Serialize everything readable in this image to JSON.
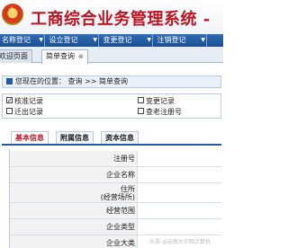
{
  "app": {
    "title": "工商综合业务管理系统 -"
  },
  "menu": [
    {
      "label": "名称登记"
    },
    {
      "label": "设立登记"
    },
    {
      "label": "变更登记"
    },
    {
      "label": "注销登记"
    }
  ],
  "tabs": [
    {
      "label": "欢迎页面"
    },
    {
      "label": "简单查询"
    }
  ],
  "location": {
    "text": "您现在的位置： 查询 >> 简单查询"
  },
  "checkboxes": [
    {
      "label": "核准记录",
      "checked": true
    },
    {
      "label": "变更记录",
      "checked": false
    },
    {
      "label": "迁出记录",
      "checked": false
    },
    {
      "label": "查老注册号",
      "checked": false
    }
  ],
  "subtabs": [
    {
      "label": "基本信息"
    },
    {
      "label": "附属信息"
    },
    {
      "label": "资本信息"
    }
  ],
  "form": {
    "fields": [
      {
        "label": "注册号"
      },
      {
        "label": "企业名称"
      },
      {
        "label": "住所\n(经营场所)"
      },
      {
        "label": "经营范围"
      },
      {
        "label": "企业类型"
      },
      {
        "label": "企业大类"
      }
    ]
  },
  "watermark": "头条 @云南大宇网计算机"
}
